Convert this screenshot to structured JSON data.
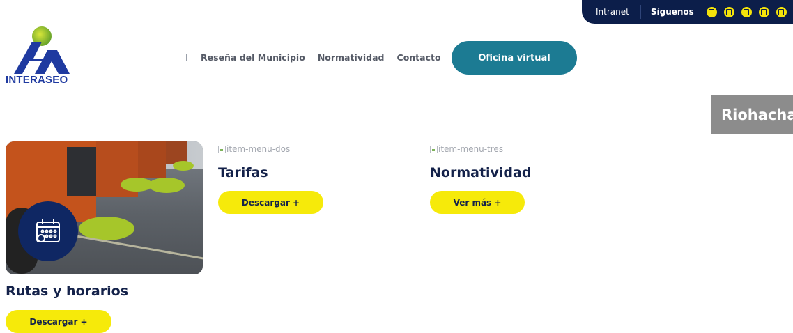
{
  "topbar": {
    "intranet": "Intranet",
    "follow": "Síguenos",
    "social_icons": [
      "social-icon-1",
      "social-icon-2",
      "social-icon-3",
      "social-icon-4",
      "social-icon-5"
    ]
  },
  "logo": {
    "text": "INTERASEO"
  },
  "nav": {
    "items": [
      "Reseña del Municipio",
      "Normatividad",
      "Contacto"
    ],
    "cta": "Oficina virtual"
  },
  "city_tag": "Riohacha",
  "cards": [
    {
      "title": "Rutas y horarios",
      "button": "Descargar +"
    },
    {
      "image_alt": "item-menu-dos",
      "title": "Tarifas",
      "button": "Descargar +"
    },
    {
      "image_alt": "item-menu-tres",
      "title": "Normatividad",
      "button": "Ver más +"
    }
  ],
  "colors": {
    "navy": "#0c1e4a",
    "teal": "#1c7b93",
    "yellow": "#f6ea0a",
    "brand_blue": "#1f3aa0"
  }
}
